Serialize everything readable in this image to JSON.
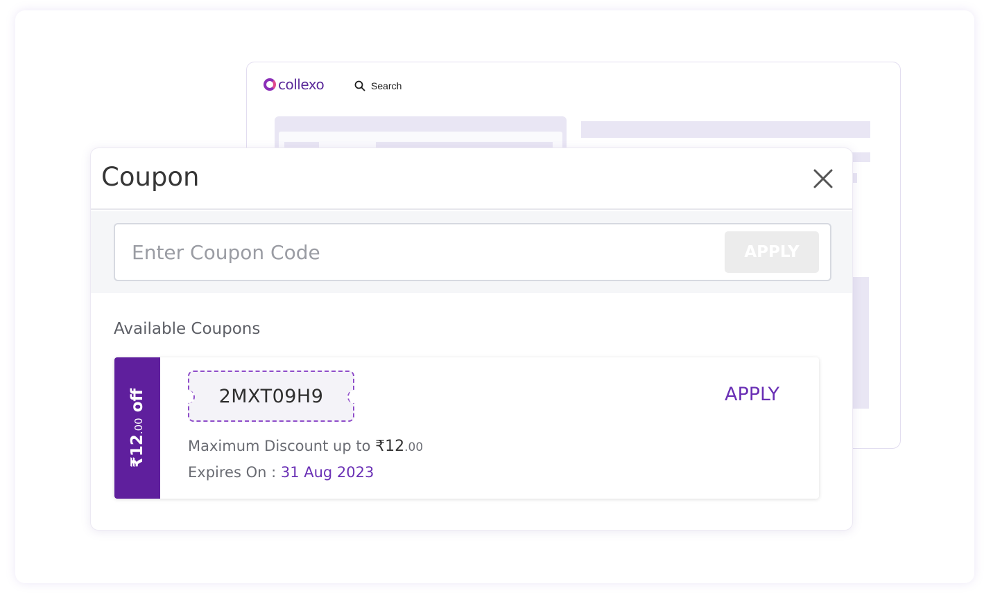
{
  "background_site": {
    "logo_text": "collexo",
    "search_label": "Search"
  },
  "modal": {
    "title": "Coupon",
    "code_input": {
      "placeholder": "Enter Coupon Code",
      "value": ""
    },
    "code_apply_label": "APPLY",
    "available_label": "Available Coupons",
    "coupons": [
      {
        "tag_amount": "₹12",
        "tag_decimal": ".00",
        "tag_suffix": " off",
        "code": "2MXT09H9",
        "apply_label": "APPLY",
        "max_discount_label": "Maximum Discount up to ",
        "max_discount_amount": "₹12",
        "max_discount_decimal": ".00",
        "expires_label": "Expires On : ",
        "expires_date": "31 Aug 2023"
      }
    ]
  },
  "colors": {
    "accent": "#5f1f9d",
    "accent_text": "#6a30b5",
    "dashed_border": "#8e4cc9"
  },
  "icons": {
    "close": "close-icon",
    "search": "search-icon"
  }
}
